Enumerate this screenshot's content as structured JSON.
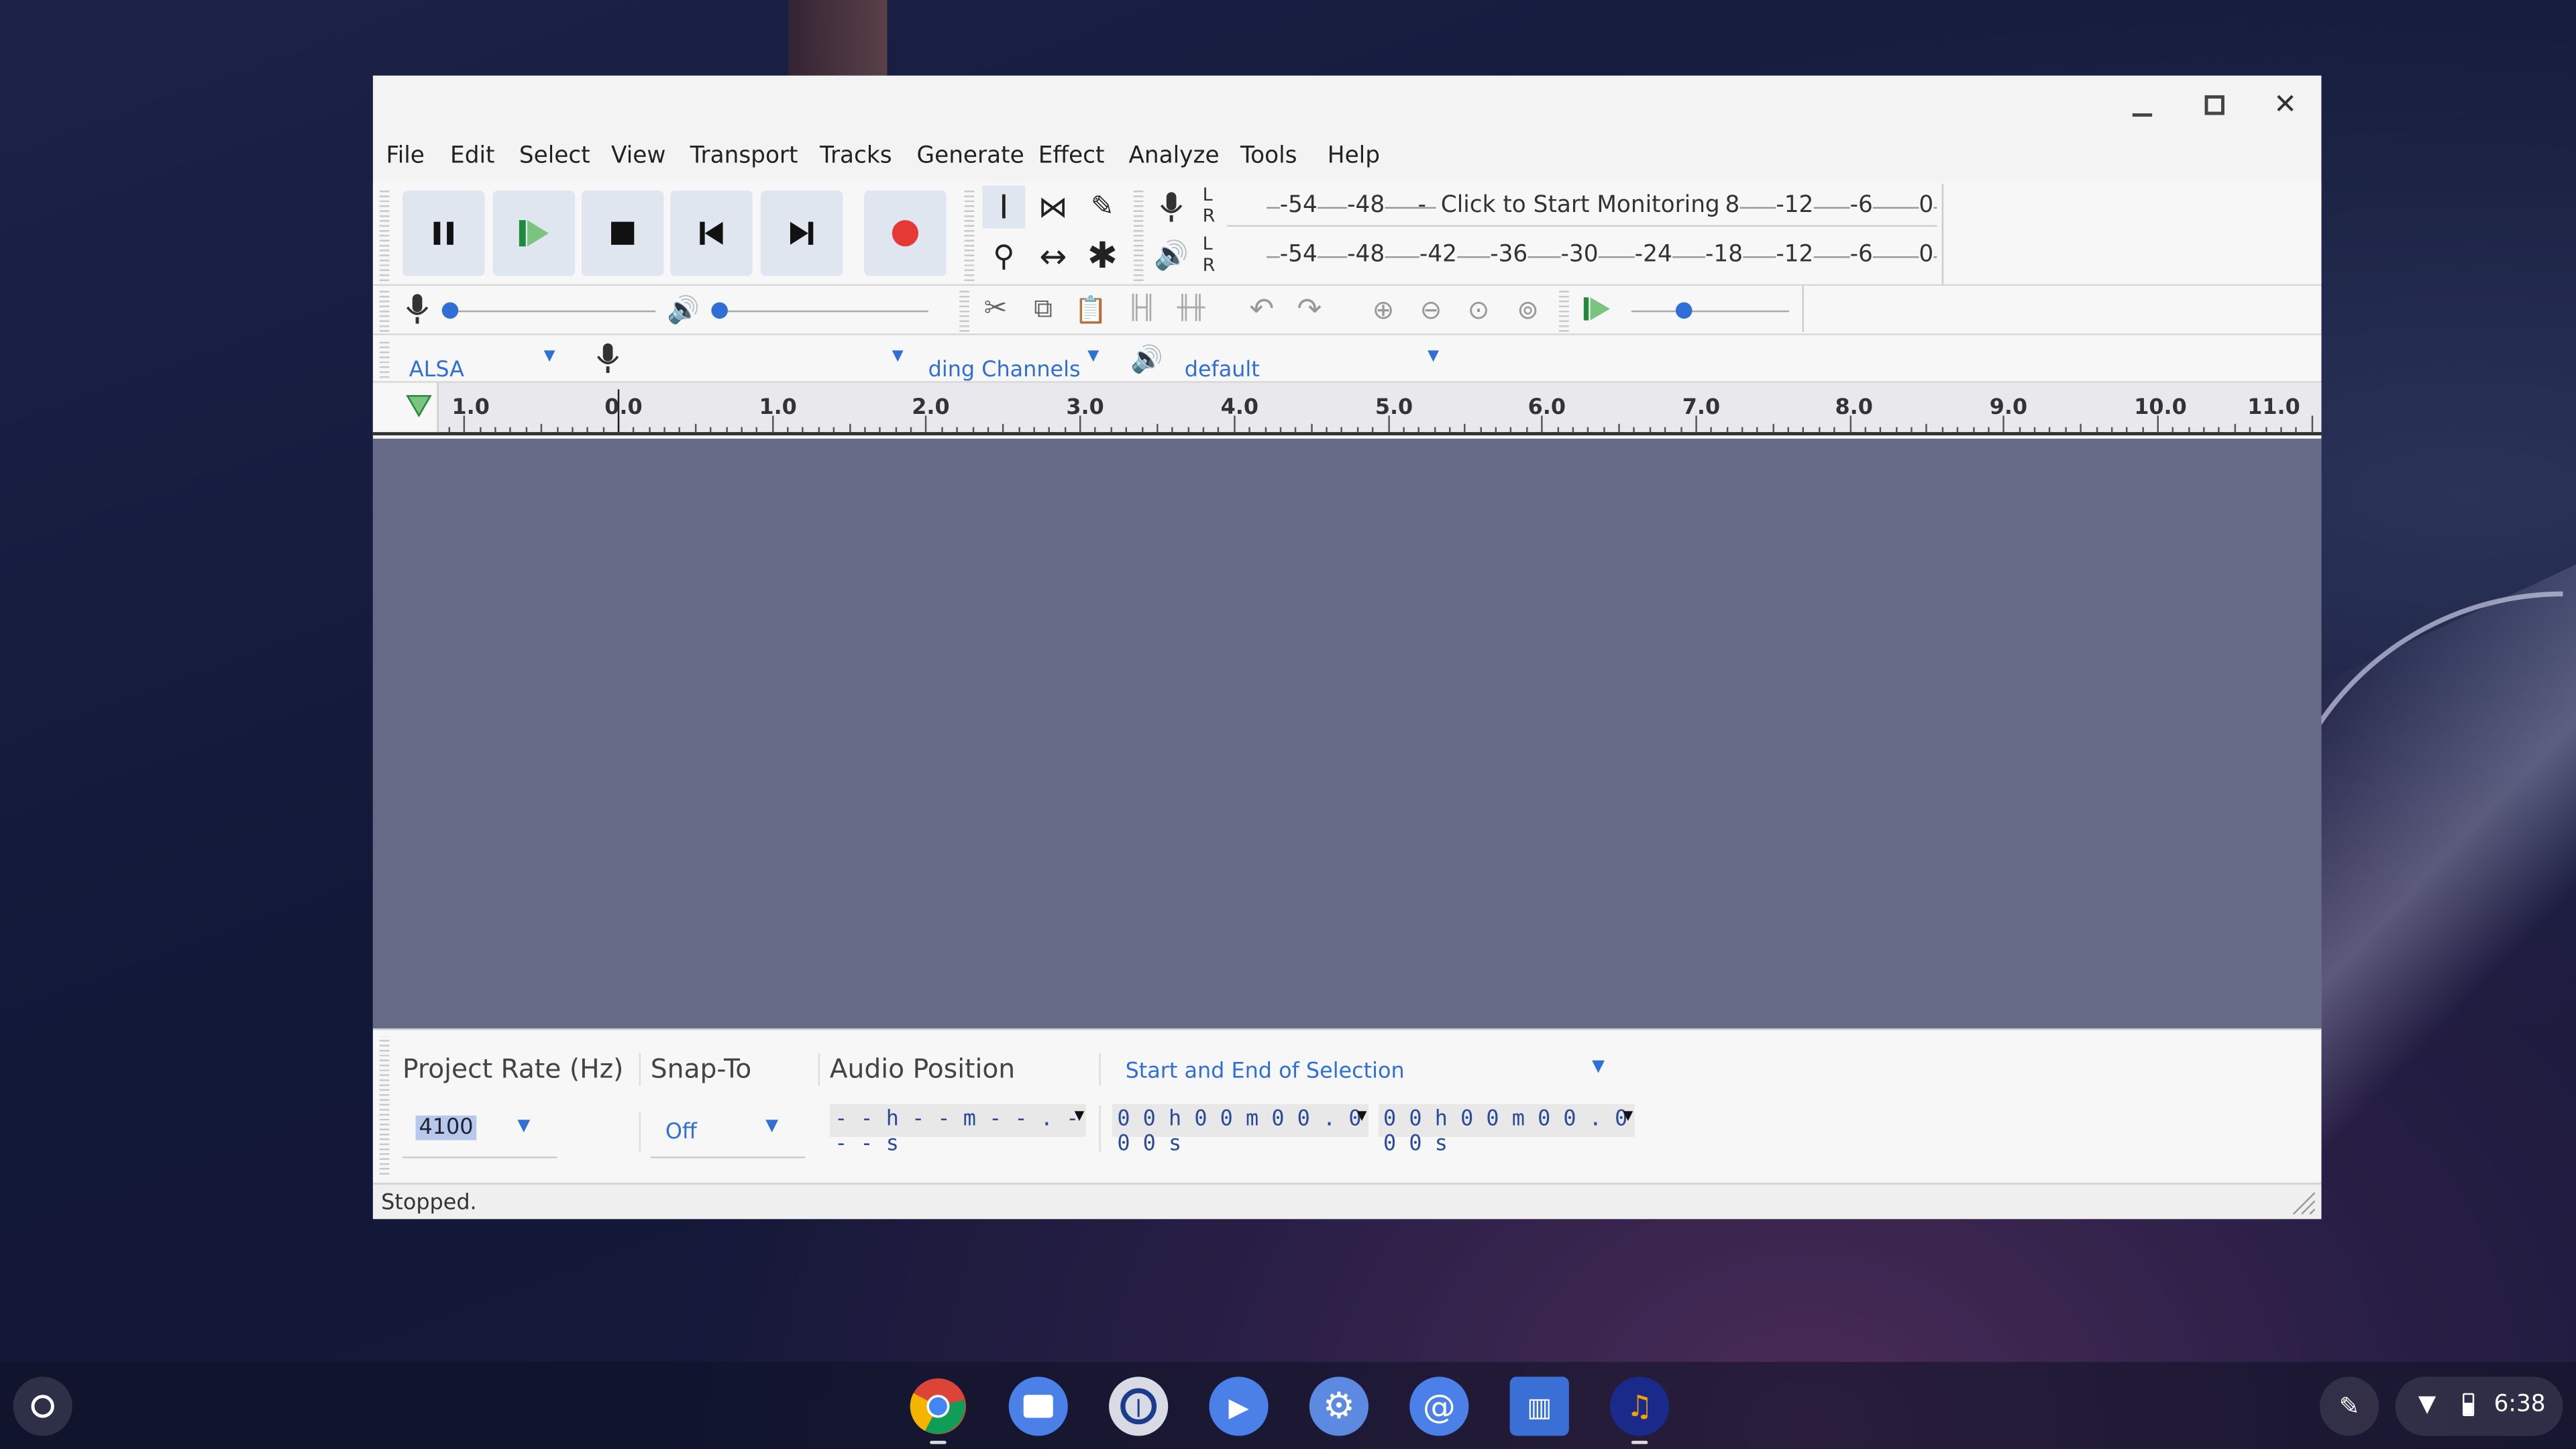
{
  "window": {
    "minimize": "⎯",
    "maximize": "☐",
    "close": "✕"
  },
  "menu": [
    "File",
    "Edit",
    "Select",
    "View",
    "Transport",
    "Tracks",
    "Generate",
    "Effect",
    "Analyze",
    "Tools",
    "Help"
  ],
  "meters": {
    "rec_L": "L",
    "rec_R": "R",
    "play_L": "L",
    "play_R": "R",
    "record_scale": [
      "-54",
      "-48",
      "-",
      "Click to Start Monitoring",
      "8",
      "-12",
      "-6",
      "0"
    ],
    "playback_scale": [
      "-54",
      "-48",
      "-42",
      "-36",
      "-30",
      "-24",
      "-18",
      "-12",
      "-6",
      "0"
    ]
  },
  "devices": {
    "host": "ALSA",
    "record_device": "",
    "channels": "ding Channels",
    "playback_device": "default"
  },
  "ruler": [
    "1.0",
    "0.0",
    "1.0",
    "2.0",
    "3.0",
    "4.0",
    "5.0",
    "6.0",
    "7.0",
    "8.0",
    "9.0",
    "10.0",
    "11.0"
  ],
  "selection_toolbar": {
    "project_rate_label": "Project Rate (Hz)",
    "project_rate_value": "4100",
    "snap_to_label": "Snap-To",
    "snap_to_value": "Off",
    "audio_position_label": "Audio Position",
    "selection_mode": "Start and End of Selection",
    "audio_position_time": "- - h - - m - - . - - - s",
    "selection_start_time": "0 0 h 0 0 m 0 0 . 0 0 0 s",
    "selection_end_time": "0 0 h 0 0 m 0 0 . 0 0 0 s"
  },
  "status": "Stopped.",
  "shelf": {
    "time": "6:38"
  },
  "colors": {
    "accent": "#2f6fd6",
    "record": "#e53935",
    "track_bg": "#666a87"
  }
}
